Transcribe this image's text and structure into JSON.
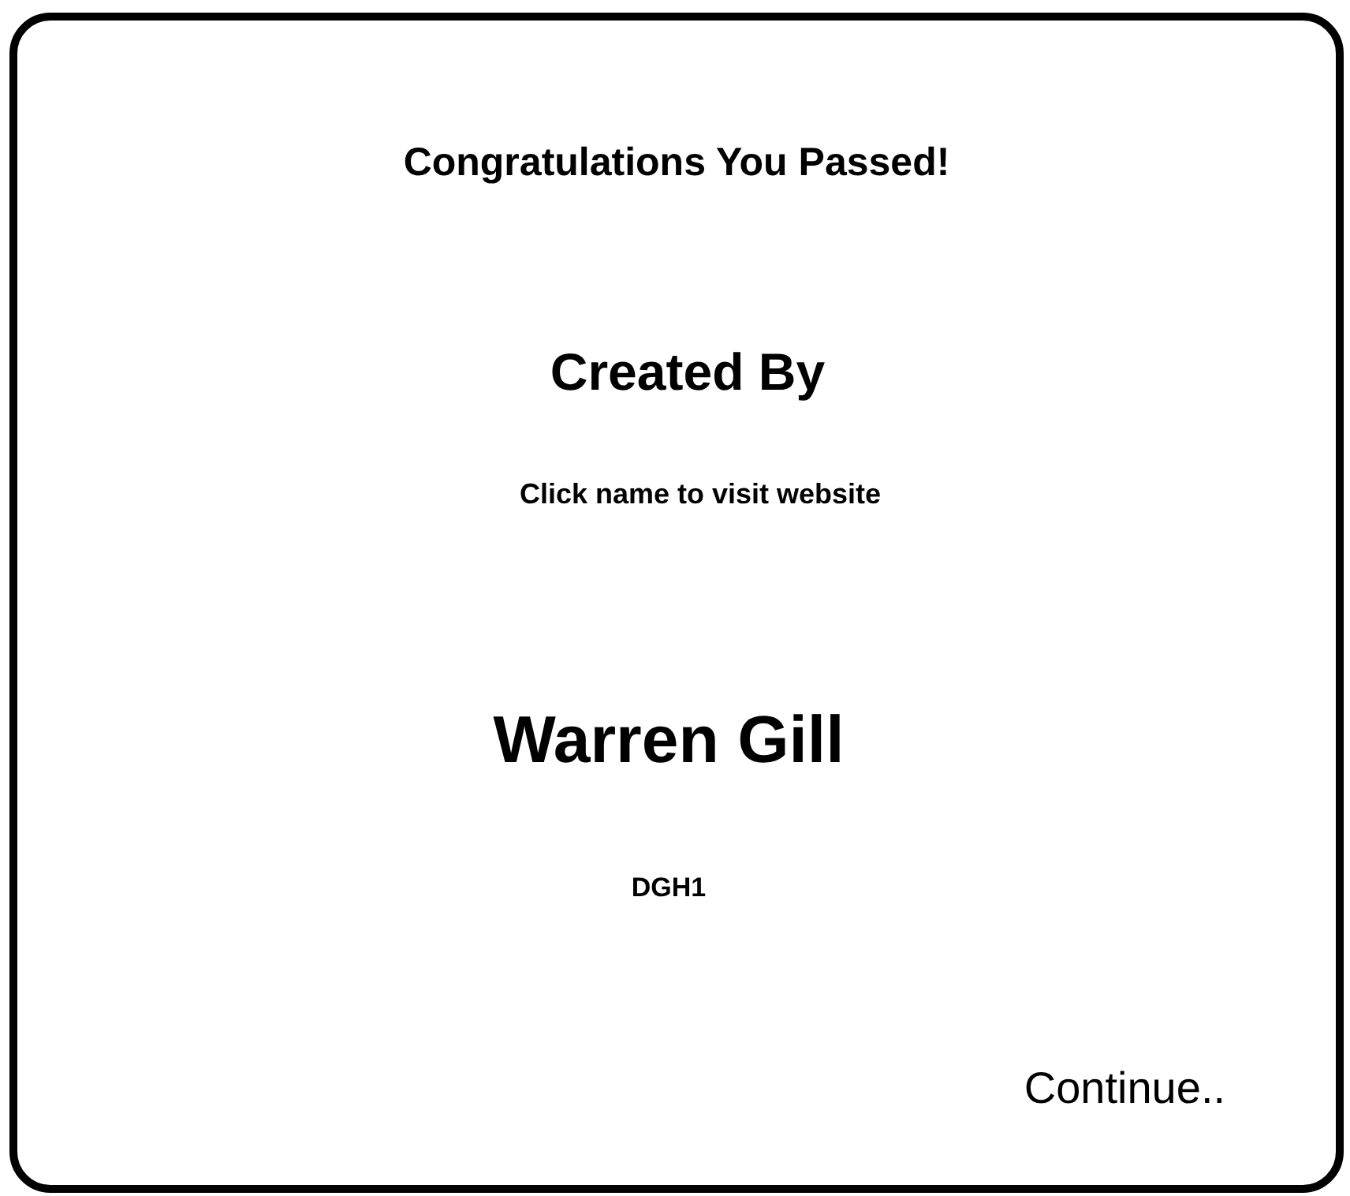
{
  "title": "Congratulations You Passed!",
  "heading": "Created By",
  "hint": "Click name to visit website",
  "author": {
    "name": "Warren Gill",
    "handle": "DGH1"
  },
  "continue_button": "Continue.."
}
